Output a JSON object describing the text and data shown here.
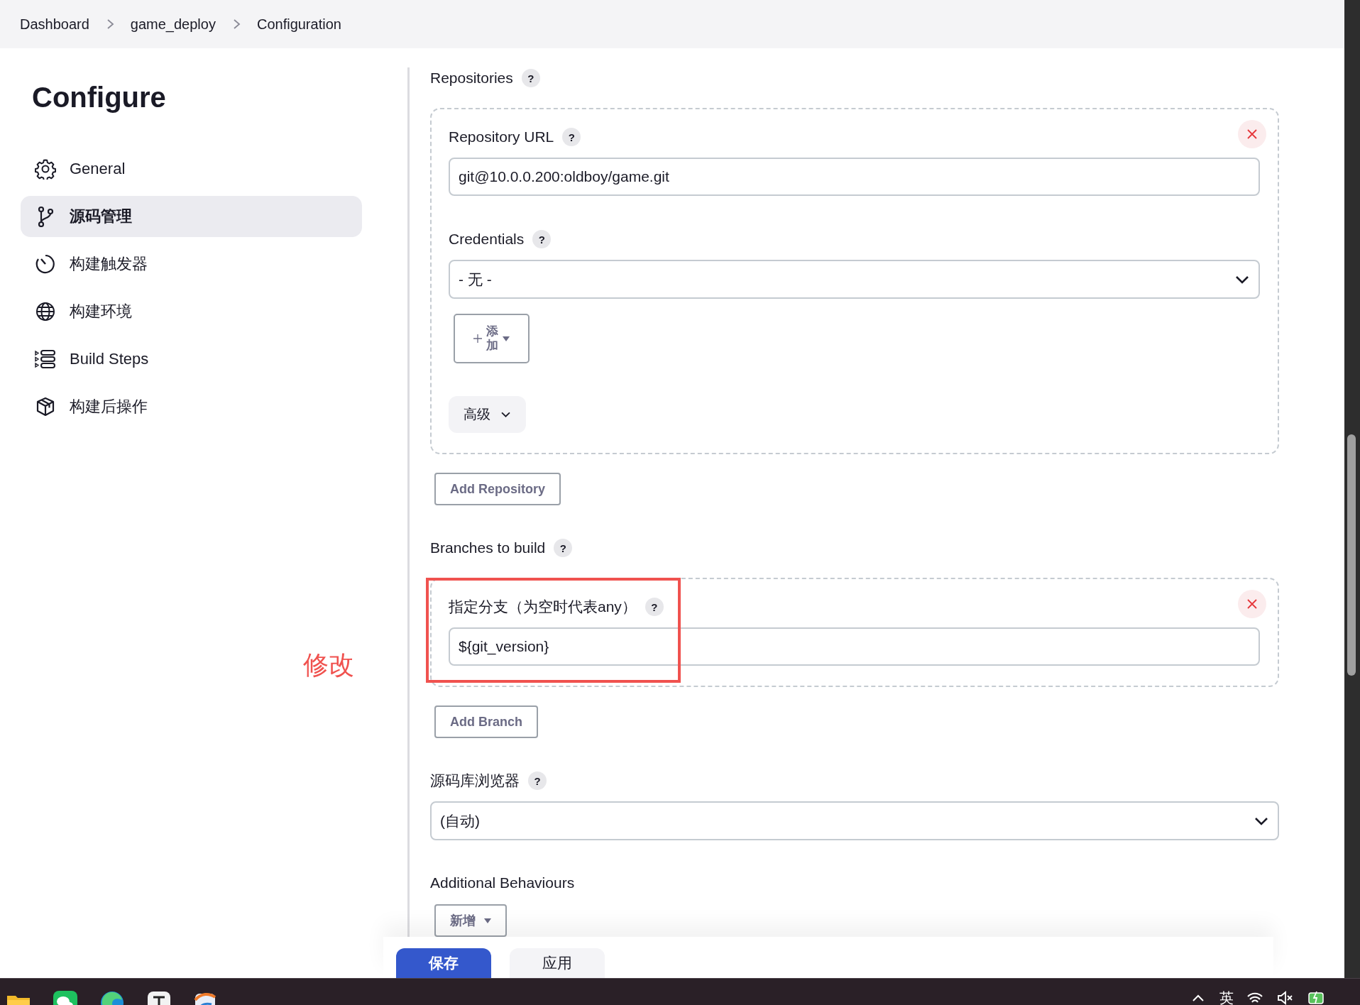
{
  "breadcrumbs": [
    {
      "label": "Dashboard"
    },
    {
      "label": "game_deploy"
    },
    {
      "label": "Configuration"
    }
  ],
  "sidebar": {
    "title": "Configure",
    "items": [
      {
        "label": "General",
        "selected": false
      },
      {
        "label": "源码管理",
        "selected": true
      },
      {
        "label": "构建触发器",
        "selected": false
      },
      {
        "label": "构建环境",
        "selected": false
      },
      {
        "label": "Build Steps",
        "selected": false
      },
      {
        "label": "构建后操作",
        "selected": false
      }
    ]
  },
  "annotation": {
    "text": "修改"
  },
  "repositories": {
    "label": "Repositories",
    "help": "?",
    "entries": [
      {
        "url_label": "Repository URL",
        "url_help": "?",
        "url_value": "git@10.0.0.200:oldboy/game.git",
        "credentials_label": "Credentials",
        "credentials_help": "?",
        "credentials_value": "- 无 -",
        "add_button": "添加",
        "advanced_button": "高级"
      }
    ],
    "add_button": "Add Repository"
  },
  "branches": {
    "label": "Branches to build",
    "help": "?",
    "entries": [
      {
        "label": "指定分支（为空时代表any）",
        "help": "?",
        "value": "${git_version}",
        "highlighted": true
      }
    ],
    "add_button": "Add Branch"
  },
  "repository_browser": {
    "label": "源码库浏览器",
    "help": "?",
    "value": "(自动)"
  },
  "additional_behaviours": {
    "label": "Additional Behaviours",
    "add_button": "新增"
  },
  "footer_buttons": [
    {
      "label": "保存",
      "kind": "primary"
    },
    {
      "label": "应用",
      "kind": "secondary"
    }
  ],
  "taskbar": {
    "tray_text": "英"
  }
}
